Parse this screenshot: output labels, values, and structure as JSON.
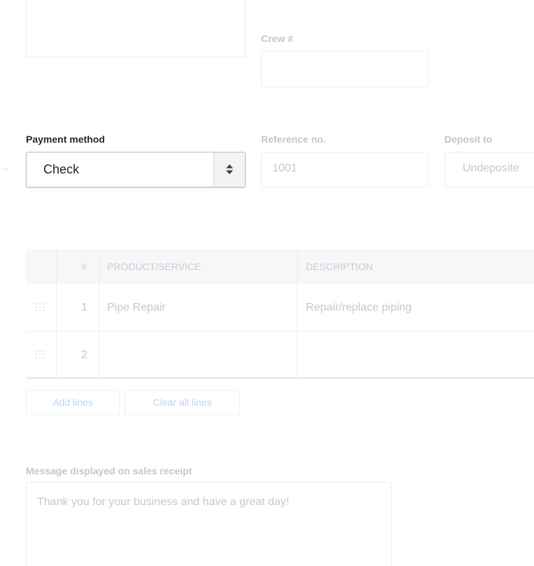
{
  "crew": {
    "label": "Crew #",
    "value": ""
  },
  "payment": {
    "label": "Payment method",
    "selected": "Check"
  },
  "reference": {
    "label": "Reference no.",
    "value": "1001"
  },
  "deposit": {
    "label": "Deposit to",
    "value": "Undeposite"
  },
  "table": {
    "headers": [
      "#",
      "PRODUCT/SERVICE",
      "DESCRIPTION"
    ],
    "rows": [
      {
        "num": "1",
        "product": "Pipe Repair",
        "description": "Repair/replace piping"
      },
      {
        "num": "2",
        "product": "",
        "description": ""
      }
    ]
  },
  "buttons": {
    "add_lines": "Add lines",
    "clear_all_lines": "Clear all lines"
  },
  "message": {
    "label": "Message displayed on sales receipt",
    "value": "Thank you for your business and have a great day!"
  },
  "colors": {
    "link": "#bdd4ea",
    "muted_text": "#c5c8cc",
    "primary_text": "#222426",
    "border": "#eceef1"
  }
}
